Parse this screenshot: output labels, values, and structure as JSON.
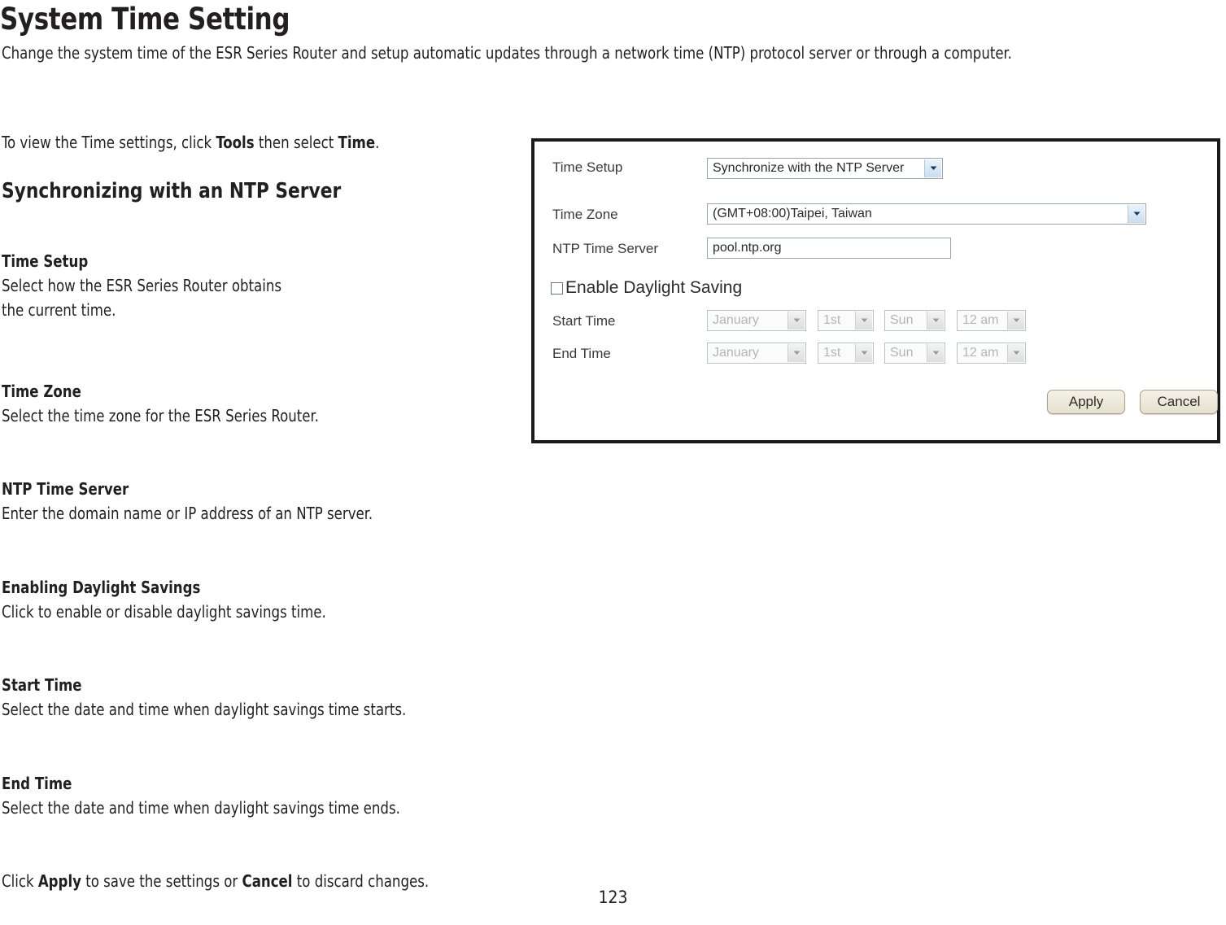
{
  "document": {
    "title": "System Time Setting",
    "intro": "Change the system time of the ESR Series Router and setup automatic updates through a network time (NTP) protocol server or through a computer.",
    "view_line": {
      "part1": "To view the Time settings, click ",
      "bold1": "Tools",
      "part2": " then select ",
      "bold2": "Time",
      "part3": "."
    },
    "section_heading": "Synchronizing with an NTP Server",
    "sections": [
      {
        "heading": "Time Setup",
        "body_line1": "Select how the ESR Series Router obtains",
        "body_line2": "the current time."
      },
      {
        "heading": "Time Zone",
        "body_line1": "Select the time zone for the ESR Series Router.",
        "body_line2": ""
      },
      {
        "heading": "NTP Time Server",
        "body_line1": "Enter the domain name or IP address of an NTP server.",
        "body_line2": ""
      },
      {
        "heading": "Enabling Daylight Savings",
        "body_line1": "Click to enable or disable daylight savings time.",
        "body_line2": ""
      },
      {
        "heading": "Start Time",
        "body_line1": "Select the date and time when daylight savings time starts.",
        "body_line2": ""
      },
      {
        "heading": "End Time",
        "body_line1": "Select the date and time when daylight savings time ends.",
        "body_line2": ""
      }
    ],
    "closing_line": {
      "part1": "Click ",
      "bold1": "Apply",
      "part2": " to save the settings or ",
      "bold2": "Cancel",
      "part3": " to discard changes."
    },
    "page_number": "123"
  },
  "screenshot": {
    "fields": {
      "time_setup_label": "Time Setup",
      "time_setup_value": "Synchronize with the NTP Server",
      "time_zone_label": "Time Zone",
      "time_zone_value": "(GMT+08:00)Taipei, Taiwan",
      "ntp_server_label": "NTP Time Server",
      "ntp_server_value": "pool.ntp.org",
      "enable_dst_label": "Enable Daylight Saving",
      "start_time_label": "Start Time",
      "end_time_label": "End Time"
    },
    "start_time": {
      "month": "January",
      "week": "1st",
      "day": "Sun",
      "hour": "12 am"
    },
    "end_time": {
      "month": "January",
      "week": "1st",
      "day": "Sun",
      "hour": "12 am"
    },
    "buttons": {
      "apply": "Apply",
      "cancel": "Cancel"
    },
    "colors": {
      "frame": "#1a1a1a",
      "field_border": "#9aa4b0",
      "dropdown_arrow": "#c9ddf1",
      "button_bg": "#ece7d7",
      "disabled_text": "#b5b5b5"
    }
  }
}
